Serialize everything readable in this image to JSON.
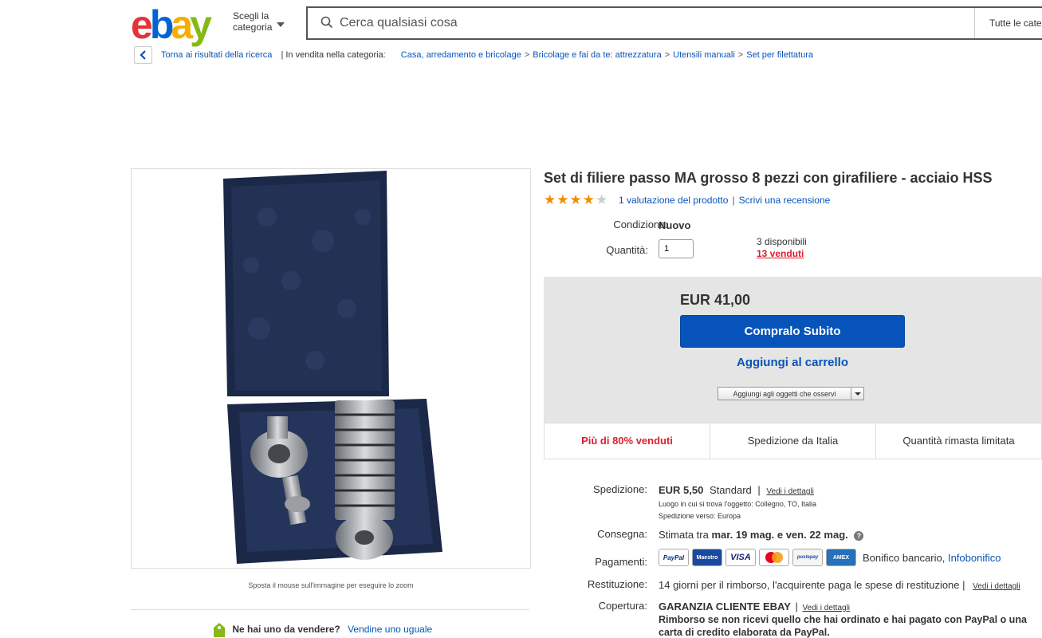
{
  "header": {
    "logo": {
      "e": "e",
      "b": "b",
      "a": "a",
      "y": "y"
    },
    "category_selector": {
      "line1": "Scegli la",
      "line2": "categoria"
    },
    "search_placeholder": "Cerca qualsiasi cosa",
    "all_categories": "Tutte le categorie"
  },
  "breadcrumb": {
    "back_label": "Torna ai risultati della ricerca",
    "in_category": "| In vendita nella categoria:",
    "items": [
      "Casa, arredamento e bricolage",
      "Bricolage e fai da te: attrezzatura",
      "Utensili manuali",
      "Set per filettatura"
    ],
    "separator": ">"
  },
  "gallery": {
    "zoom_hint": "Sposta il mouse sull'immagine per eseguire lo zoom",
    "case_color": "#1b2847"
  },
  "sell": {
    "question": "Ne hai uno da vendere?",
    "link": "Vendine uno uguale"
  },
  "product": {
    "title": "Set di filiere passo MA grosso 8 pezzi con girafiliere - acciaio HSS",
    "rating_stars": 4,
    "rating_max": 5,
    "rating_count_label": "1 valutazione del prodotto",
    "write_review": "Scrivi una recensione",
    "condition_label": "Condizione:",
    "condition_value": "Nuovo",
    "quantity_label": "Quantità:",
    "quantity_value": "1",
    "available": "3 disponibili",
    "sold": "13 venduti"
  },
  "buy": {
    "price": "EUR 41,00",
    "buy_now": "Compralo Subito",
    "add_cart": "Aggiungi al carrello",
    "watch": "Aggiungi agli oggetti che osservi"
  },
  "badges": [
    "Più di 80% venduti",
    "Spedizione da Italia",
    "Quantità rimasta limitata"
  ],
  "shipping": {
    "label": "Spedizione:",
    "price": "EUR 5,50",
    "type": "Standard",
    "details": "Vedi i dettagli",
    "location": "Luogo in cui si trova l'oggetto:  Collegno, TO, Italia",
    "ships_to": "Spedizione verso:  Europa"
  },
  "delivery": {
    "label": "Consegna:",
    "prefix": "Stimata tra",
    "dates": "mar. 19 mag. e ven. 22 mag.",
    "help": "?"
  },
  "payments": {
    "label": "Pagamenti:",
    "methods": [
      "PayPal",
      "Maestro",
      "VISA",
      "MC",
      "postepay",
      "AMEX"
    ],
    "bank_text": "Bonifico bancario,",
    "bank_link": "Infobonifico"
  },
  "returns": {
    "label": "Restituzione:",
    "text": "14 giorni per il rimborso, l'acquirente paga le spese di restituzione |",
    "details": "Vedi i dettagli"
  },
  "coverage": {
    "label": "Copertura:",
    "title": "GARANZIA CLIENTE EBAY",
    "details": "Vedi i dettagli",
    "line1": "Rimborso se non ricevi quello che hai ordinato e hai pagato con PayPal o una",
    "line2": "carta di credito elaborata da PayPal."
  },
  "colors": {
    "link": "#0654ba",
    "red": "#dd1e31",
    "star": "#f18e00",
    "button": "#0654ba"
  }
}
